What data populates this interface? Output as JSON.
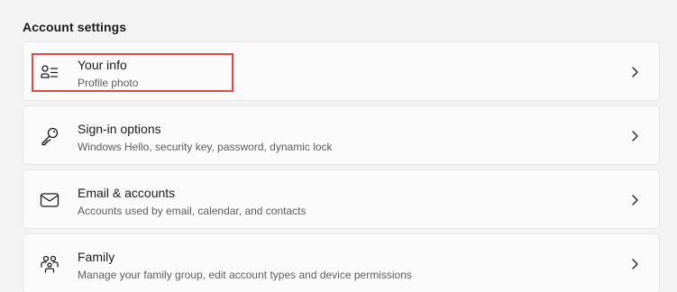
{
  "section": {
    "title": "Account settings"
  },
  "items": [
    {
      "icon": "your-info-icon",
      "title": "Your info",
      "description": "Profile photo"
    },
    {
      "icon": "key-icon",
      "title": "Sign-in options",
      "description": "Windows Hello, security key, password, dynamic lock"
    },
    {
      "icon": "mail-icon",
      "title": "Email & accounts",
      "description": "Accounts used by email, calendar, and contacts"
    },
    {
      "icon": "family-icon",
      "title": "Family",
      "description": "Manage your family group, edit account types and device permissions"
    }
  ],
  "colors": {
    "background": "#f3f3f3",
    "card": "#fbfbfb",
    "highlight": "#e24a4a"
  }
}
